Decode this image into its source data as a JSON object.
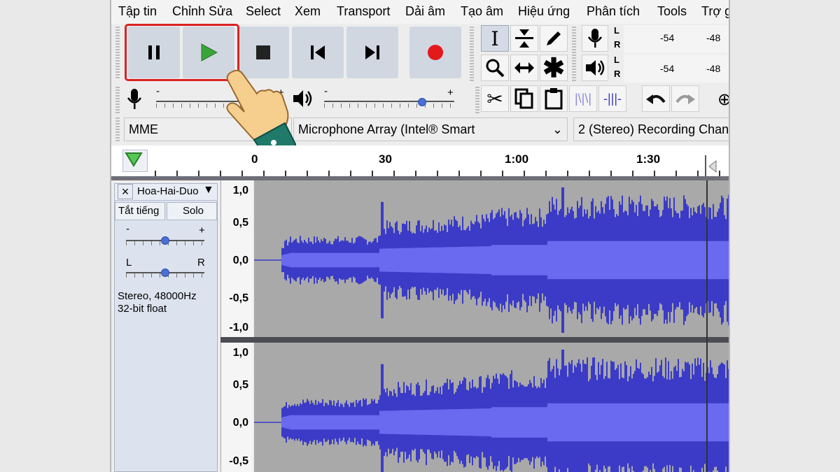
{
  "menu": [
    "Tập tin",
    "Chỉnh Sửa",
    "Select",
    "Xem",
    "Transport",
    "Dải âm",
    "Tạo âm",
    "Hiệu ứng",
    "Phân tích",
    "Tools",
    "Trợ g"
  ],
  "meter": {
    "record_L": "L",
    "record_R": "R",
    "play_L": "L",
    "play_R": "R",
    "rec_v1": "-54",
    "rec_v2": "-48",
    "play_v1": "-54",
    "play_v2": "-48"
  },
  "mixer": {
    "mic_minus": "-",
    "mic_plus": "+",
    "spk_minus": "-",
    "spk_plus": "+",
    "playback_volume": 0.75
  },
  "device": {
    "host": "MME",
    "input": "Microphone Array (Intel® Smart",
    "channels": "2 (Stereo) Recording Chann"
  },
  "ruler": {
    "labels": [
      "0",
      "30",
      "1:00",
      "1:30"
    ]
  },
  "track": {
    "close": "×",
    "name": "Hoa-Hai-Duo",
    "mute": "Tắt tiếng",
    "solo": "Solo",
    "gain_minus": "-",
    "gain_plus": "+",
    "pan_left": "L",
    "pan_right": "R",
    "info_rate": "Stereo, 48000Hz",
    "info_format": "32-bit float",
    "gain": 0.5,
    "pan": 0.5
  },
  "yaxis_top": [
    "1,0",
    "0,5",
    "0,0",
    "-0,5",
    "-1,0"
  ],
  "yaxis_bottom": [
    "1,0",
    "0,5",
    "0,0",
    "-0,5"
  ],
  "colors": {
    "wave": "#3b3bc7",
    "wave_rms": "#6a6af0",
    "record_button": "#e21a1a",
    "play_button": "#3aa33a",
    "highlight": "#dd2222"
  }
}
